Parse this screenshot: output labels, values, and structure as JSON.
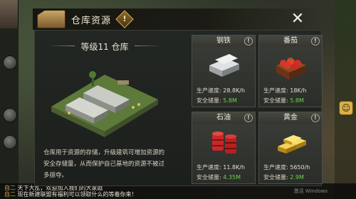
{
  "dialog": {
    "title": "仓库资源",
    "info_glyph": "!",
    "close_glyph": "✕"
  },
  "warehouse": {
    "level_title": "等级11 仓库",
    "description": "仓库用于资源的存储，升级建筑可增加资源的安全存储量，从而保护自己基地的资源不被过多掠夺。"
  },
  "stat_labels": {
    "rate": "生产速度:",
    "safe": "安全储量:"
  },
  "resources": [
    {
      "name": "钢铁",
      "rate": "28.8K/h",
      "safe": "5.8M",
      "icon": "steel-ingot-icon"
    },
    {
      "name": "番茄",
      "rate": "18K/h",
      "safe": "5.8M",
      "icon": "tomato-crate-icon"
    },
    {
      "name": "石油",
      "rate": "11.8K/h",
      "safe": "4.35M",
      "icon": "oil-barrel-icon"
    },
    {
      "name": "黄金",
      "rate": "5650/h",
      "safe": "2.9M",
      "icon": "gold-bar-icon"
    }
  ],
  "resource_info_glyph": "!",
  "colors": {
    "safe_value": "#6ed44a",
    "accent_gold": "#d9b45a"
  },
  "background": {
    "chat_line1_prefix": "自二",
    "chat_line1": "天下大乱，欢迎加入我们的大家庭",
    "chat_line2_prefix": "自二",
    "chat_line2": "现在新建联盟有福利可以领取什么的等着你来！",
    "watermark": "激活 Windows",
    "emote": "☺"
  }
}
